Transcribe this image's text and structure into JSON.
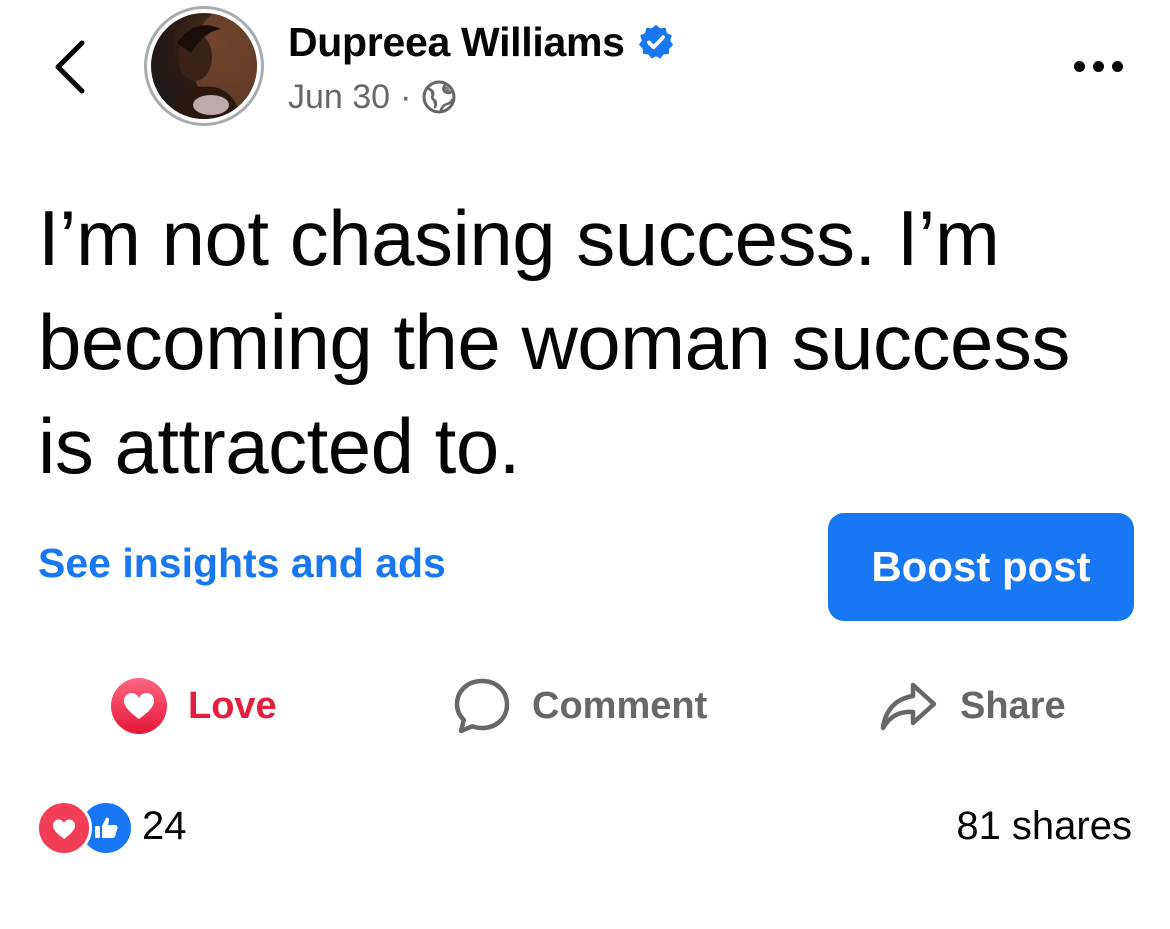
{
  "header": {
    "author_name": "Dupreea Williams",
    "verified": true,
    "date": "Jun 30",
    "separator": "·",
    "audience_icon": "globe-icon",
    "back_icon": "chevron-left-icon",
    "more_icon": "more-horizontal-icon"
  },
  "post": {
    "text": "I’m not chasing success. I’m becoming the woman success is attracted to."
  },
  "promo": {
    "insights_label": "See insights and ads",
    "boost_label": "Boost post"
  },
  "actions": [
    {
      "label": "Love",
      "icon": "heart-reaction-icon",
      "active": true
    },
    {
      "label": "Comment",
      "icon": "comment-bubble-icon",
      "active": false
    },
    {
      "label": "Share",
      "icon": "share-arrow-icon",
      "active": false
    }
  ],
  "stats": {
    "reaction_icons": [
      "love-reaction-icon",
      "like-reaction-icon"
    ],
    "reaction_count": "24",
    "shares": "81 shares"
  },
  "colors": {
    "accent": "#1877f2",
    "love": "#e41e3f",
    "secondary_text": "#65676b",
    "primary_text": "#050505"
  }
}
